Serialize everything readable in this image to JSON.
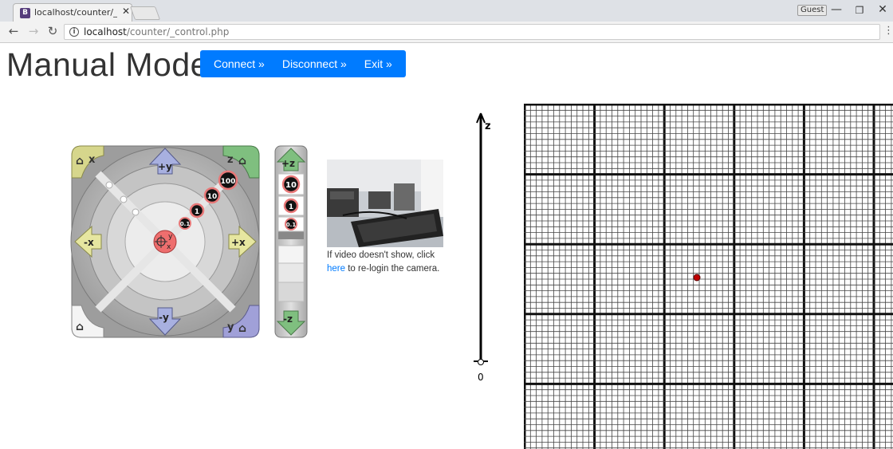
{
  "browser": {
    "tab_title": "localhost/counter/_contr",
    "tab_favicon": "B",
    "guest_label": "Guest",
    "url_host": "localhost",
    "url_path": "/counter/_control.php"
  },
  "page": {
    "title": "Manual Mode",
    "buttons": {
      "connect": "Connect »",
      "disconnect": "Disconnect »",
      "exit": "Exit »"
    }
  },
  "jog": {
    "home_x": "x",
    "home_z": "z",
    "home_y": "y",
    "plus_y": "+y",
    "minus_y": "-y",
    "plus_x": "+x",
    "minus_x": "-x",
    "plus_z": "+z",
    "minus_z": "-z",
    "steps": [
      "100",
      "10",
      "1",
      "0.1"
    ],
    "z_steps": [
      "10",
      "1",
      "0.1"
    ],
    "center_y": "y",
    "center_x": "x"
  },
  "camera": {
    "caption_pre": "If video doesn't show, click",
    "link": "here",
    "caption_post": "to re-login the camera."
  },
  "zaxis": {
    "label": "z",
    "zero": "0"
  },
  "colors": {
    "accent": "#007bff",
    "marker": "#c00000"
  }
}
